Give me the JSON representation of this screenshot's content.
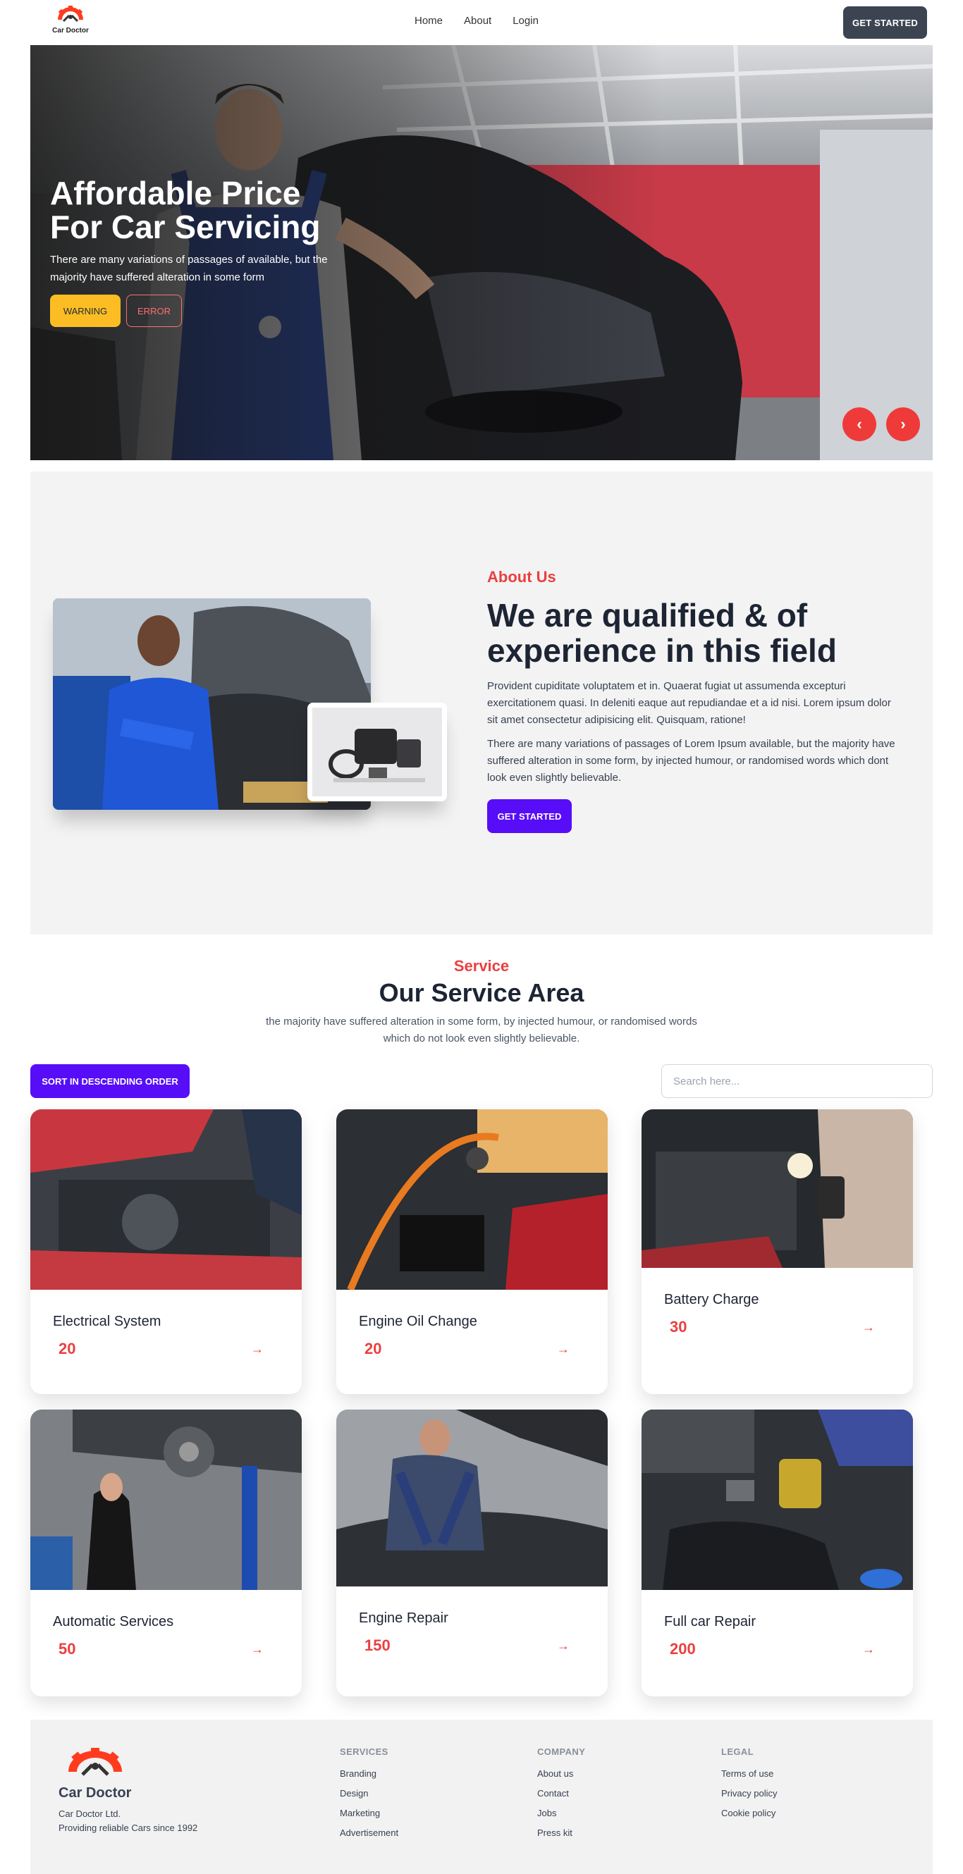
{
  "brand": {
    "name": "Car Doctor"
  },
  "nav": {
    "links": [
      "Home",
      "About",
      "Login"
    ],
    "cta": "GET STARTED"
  },
  "hero": {
    "title_line1": "Affordable Price",
    "title_line2": "For Car Servicing",
    "text": "There are many variations of passages of available, but the majority have suffered alteration in some form",
    "btn_warning": "WARNING",
    "btn_error": "ERROR",
    "prev_icon": "‹",
    "next_icon": "›"
  },
  "about": {
    "kicker": "About Us",
    "title": "We are qualified & of experience in this field",
    "p1": "Provident cupiditate voluptatem et in. Quaerat fugiat ut assumenda excepturi exercitationem quasi. In deleniti eaque aut repudiandae et a id nisi. Lorem ipsum dolor sit amet consectetur adipisicing elit. Quisquam, ratione!",
    "p2": "There are many variations of passages of Lorem Ipsum available, but the majority have suffered alteration in some form, by injected humour, or randomised words which dont look even slightly believable.",
    "cta": "GET STARTED"
  },
  "services": {
    "kicker": "Service",
    "title": "Our Service Area",
    "subtitle": "the majority have suffered alteration in some form, by injected humour, or randomised words which do not look even slightly believable.",
    "sort_label": "SORT IN DESCENDING ORDER",
    "search_placeholder": "Search here...",
    "arrow_icon": "→",
    "items": [
      {
        "title": "Electrical System",
        "price": "20"
      },
      {
        "title": "Engine Oil Change",
        "price": "20"
      },
      {
        "title": "Battery Charge",
        "price": "30"
      },
      {
        "title": "Automatic Services",
        "price": "50"
      },
      {
        "title": "Engine Repair",
        "price": "150"
      },
      {
        "title": "Full car Repair",
        "price": "200"
      }
    ]
  },
  "footer": {
    "brand": "Car Doctor",
    "ltd": "Car Doctor Ltd.",
    "tagline": "Providing reliable Cars since 1992",
    "services": {
      "heading": "SERVICES",
      "links": [
        "Branding",
        "Design",
        "Marketing",
        "Advertisement"
      ]
    },
    "company": {
      "heading": "COMPANY",
      "links": [
        "About us",
        "Contact",
        "Jobs",
        "Press kit"
      ]
    },
    "legal": {
      "heading": "LEGAL",
      "links": [
        "Terms of use",
        "Privacy policy",
        "Cookie policy"
      ]
    }
  },
  "colors": {
    "accent": "#e94040",
    "primary": "#570df8",
    "dark": "#3d4451",
    "warning": "#fbbd23"
  }
}
